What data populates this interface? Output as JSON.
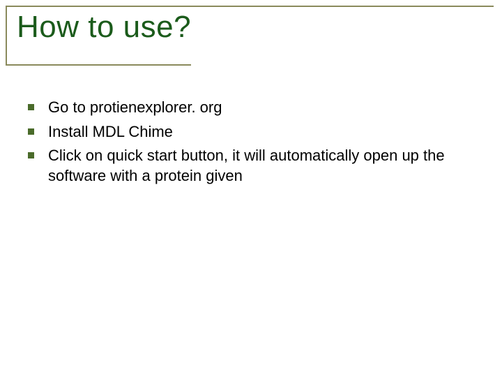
{
  "title": "How to use?",
  "bullets": [
    {
      "text": "Go to protienexplorer. org"
    },
    {
      "text": "Install MDL Chime"
    },
    {
      "text": "Click on quick start button, it will automatically open up the software with a protein given"
    }
  ]
}
